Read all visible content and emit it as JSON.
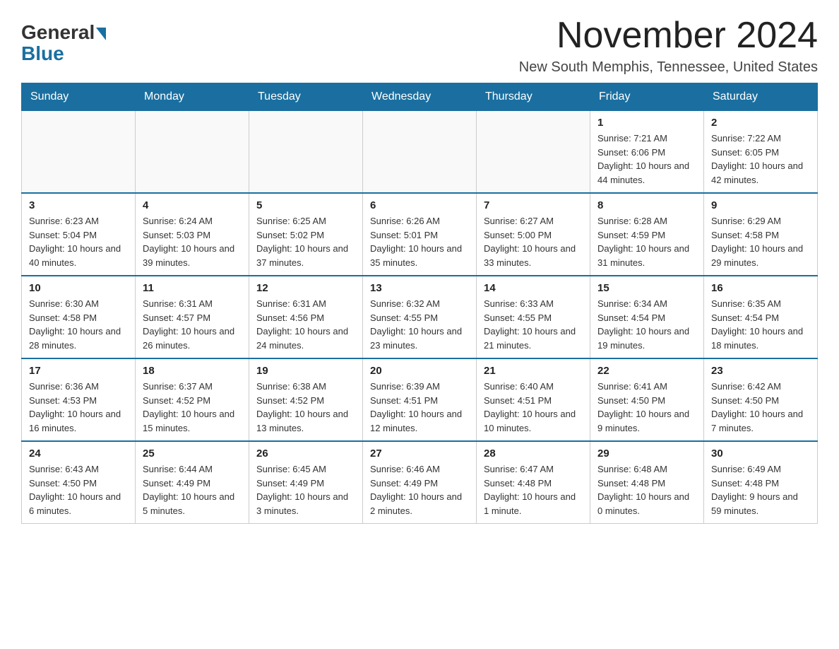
{
  "header": {
    "logo_general": "General",
    "logo_blue": "Blue",
    "month_title": "November 2024",
    "location": "New South Memphis, Tennessee, United States"
  },
  "days_of_week": [
    "Sunday",
    "Monday",
    "Tuesday",
    "Wednesday",
    "Thursday",
    "Friday",
    "Saturday"
  ],
  "weeks": [
    [
      {
        "day": "",
        "info": ""
      },
      {
        "day": "",
        "info": ""
      },
      {
        "day": "",
        "info": ""
      },
      {
        "day": "",
        "info": ""
      },
      {
        "day": "",
        "info": ""
      },
      {
        "day": "1",
        "info": "Sunrise: 7:21 AM\nSunset: 6:06 PM\nDaylight: 10 hours and 44 minutes."
      },
      {
        "day": "2",
        "info": "Sunrise: 7:22 AM\nSunset: 6:05 PM\nDaylight: 10 hours and 42 minutes."
      }
    ],
    [
      {
        "day": "3",
        "info": "Sunrise: 6:23 AM\nSunset: 5:04 PM\nDaylight: 10 hours and 40 minutes."
      },
      {
        "day": "4",
        "info": "Sunrise: 6:24 AM\nSunset: 5:03 PM\nDaylight: 10 hours and 39 minutes."
      },
      {
        "day": "5",
        "info": "Sunrise: 6:25 AM\nSunset: 5:02 PM\nDaylight: 10 hours and 37 minutes."
      },
      {
        "day": "6",
        "info": "Sunrise: 6:26 AM\nSunset: 5:01 PM\nDaylight: 10 hours and 35 minutes."
      },
      {
        "day": "7",
        "info": "Sunrise: 6:27 AM\nSunset: 5:00 PM\nDaylight: 10 hours and 33 minutes."
      },
      {
        "day": "8",
        "info": "Sunrise: 6:28 AM\nSunset: 4:59 PM\nDaylight: 10 hours and 31 minutes."
      },
      {
        "day": "9",
        "info": "Sunrise: 6:29 AM\nSunset: 4:58 PM\nDaylight: 10 hours and 29 minutes."
      }
    ],
    [
      {
        "day": "10",
        "info": "Sunrise: 6:30 AM\nSunset: 4:58 PM\nDaylight: 10 hours and 28 minutes."
      },
      {
        "day": "11",
        "info": "Sunrise: 6:31 AM\nSunset: 4:57 PM\nDaylight: 10 hours and 26 minutes."
      },
      {
        "day": "12",
        "info": "Sunrise: 6:31 AM\nSunset: 4:56 PM\nDaylight: 10 hours and 24 minutes."
      },
      {
        "day": "13",
        "info": "Sunrise: 6:32 AM\nSunset: 4:55 PM\nDaylight: 10 hours and 23 minutes."
      },
      {
        "day": "14",
        "info": "Sunrise: 6:33 AM\nSunset: 4:55 PM\nDaylight: 10 hours and 21 minutes."
      },
      {
        "day": "15",
        "info": "Sunrise: 6:34 AM\nSunset: 4:54 PM\nDaylight: 10 hours and 19 minutes."
      },
      {
        "day": "16",
        "info": "Sunrise: 6:35 AM\nSunset: 4:54 PM\nDaylight: 10 hours and 18 minutes."
      }
    ],
    [
      {
        "day": "17",
        "info": "Sunrise: 6:36 AM\nSunset: 4:53 PM\nDaylight: 10 hours and 16 minutes."
      },
      {
        "day": "18",
        "info": "Sunrise: 6:37 AM\nSunset: 4:52 PM\nDaylight: 10 hours and 15 minutes."
      },
      {
        "day": "19",
        "info": "Sunrise: 6:38 AM\nSunset: 4:52 PM\nDaylight: 10 hours and 13 minutes."
      },
      {
        "day": "20",
        "info": "Sunrise: 6:39 AM\nSunset: 4:51 PM\nDaylight: 10 hours and 12 minutes."
      },
      {
        "day": "21",
        "info": "Sunrise: 6:40 AM\nSunset: 4:51 PM\nDaylight: 10 hours and 10 minutes."
      },
      {
        "day": "22",
        "info": "Sunrise: 6:41 AM\nSunset: 4:50 PM\nDaylight: 10 hours and 9 minutes."
      },
      {
        "day": "23",
        "info": "Sunrise: 6:42 AM\nSunset: 4:50 PM\nDaylight: 10 hours and 7 minutes."
      }
    ],
    [
      {
        "day": "24",
        "info": "Sunrise: 6:43 AM\nSunset: 4:50 PM\nDaylight: 10 hours and 6 minutes."
      },
      {
        "day": "25",
        "info": "Sunrise: 6:44 AM\nSunset: 4:49 PM\nDaylight: 10 hours and 5 minutes."
      },
      {
        "day": "26",
        "info": "Sunrise: 6:45 AM\nSunset: 4:49 PM\nDaylight: 10 hours and 3 minutes."
      },
      {
        "day": "27",
        "info": "Sunrise: 6:46 AM\nSunset: 4:49 PM\nDaylight: 10 hours and 2 minutes."
      },
      {
        "day": "28",
        "info": "Sunrise: 6:47 AM\nSunset: 4:48 PM\nDaylight: 10 hours and 1 minute."
      },
      {
        "day": "29",
        "info": "Sunrise: 6:48 AM\nSunset: 4:48 PM\nDaylight: 10 hours and 0 minutes."
      },
      {
        "day": "30",
        "info": "Sunrise: 6:49 AM\nSunset: 4:48 PM\nDaylight: 9 hours and 59 minutes."
      }
    ]
  ]
}
